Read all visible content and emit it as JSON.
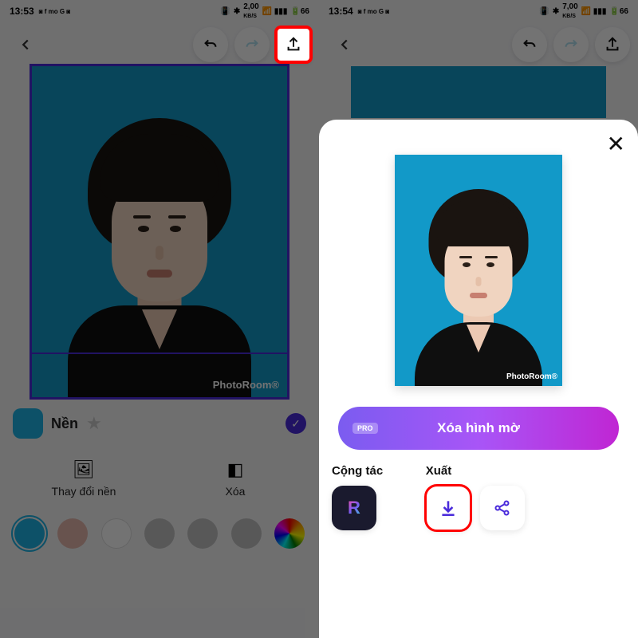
{
  "status": {
    "time_left": "13:53",
    "time_right": "13:54",
    "net_left": "2,00",
    "net_right": "7,00",
    "net_unit": "KB/S",
    "battery": "66"
  },
  "editor": {
    "watermark": "PhotoRoom®",
    "row_label": "Nền",
    "change_bg": "Thay đổi nền",
    "erase": "Xóa",
    "colors": [
      {
        "hex": "#1db4e6",
        "selected": true
      },
      {
        "hex": "#e6b8ad",
        "selected": false
      },
      {
        "hex": "#ffffff",
        "selected": false
      },
      {
        "hex": "#bfbfbf",
        "selected": false
      },
      {
        "hex": "#bfbfbf",
        "selected": false
      },
      {
        "hex": "#bfbfbf",
        "selected": false
      },
      {
        "hex": "rainbow",
        "selected": false
      }
    ]
  },
  "export": {
    "cta_pro": "PRO",
    "cta_label": "Xóa hình mờ",
    "collab_title": "Cộng tác",
    "export_title": "Xuất"
  }
}
